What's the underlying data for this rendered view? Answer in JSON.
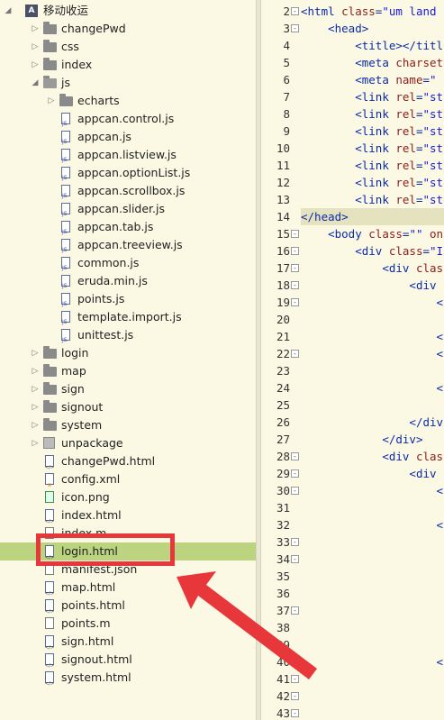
{
  "tree": {
    "root": {
      "label": "移动收运"
    },
    "items": [
      {
        "label": "changePwd",
        "type": "folder",
        "depth": 1,
        "expanded": false
      },
      {
        "label": "css",
        "type": "folder",
        "depth": 1,
        "expanded": false
      },
      {
        "label": "index",
        "type": "folder",
        "depth": 1,
        "expanded": false
      },
      {
        "label": "js",
        "type": "folder",
        "depth": 1,
        "expanded": true
      },
      {
        "label": "echarts",
        "type": "folder",
        "depth": 2,
        "expanded": false
      },
      {
        "label": "appcan.control.js",
        "type": "js",
        "depth": 2
      },
      {
        "label": "appcan.js",
        "type": "js",
        "depth": 2
      },
      {
        "label": "appcan.listview.js",
        "type": "js",
        "depth": 2
      },
      {
        "label": "appcan.optionList.js",
        "type": "js",
        "depth": 2
      },
      {
        "label": "appcan.scrollbox.js",
        "type": "js",
        "depth": 2
      },
      {
        "label": "appcan.slider.js",
        "type": "js",
        "depth": 2
      },
      {
        "label": "appcan.tab.js",
        "type": "js",
        "depth": 2
      },
      {
        "label": "appcan.treeview.js",
        "type": "js",
        "depth": 2
      },
      {
        "label": "common.js",
        "type": "js",
        "depth": 2
      },
      {
        "label": "eruda.min.js",
        "type": "js",
        "depth": 2
      },
      {
        "label": "points.js",
        "type": "js",
        "depth": 2
      },
      {
        "label": "template.import.js",
        "type": "js",
        "depth": 2
      },
      {
        "label": "unittest.js",
        "type": "js",
        "depth": 2
      },
      {
        "label": "login",
        "type": "folder",
        "depth": 1,
        "expanded": false
      },
      {
        "label": "map",
        "type": "folder",
        "depth": 1,
        "expanded": false
      },
      {
        "label": "sign",
        "type": "folder",
        "depth": 1,
        "expanded": false
      },
      {
        "label": "signout",
        "type": "folder",
        "depth": 1,
        "expanded": false
      },
      {
        "label": "system",
        "type": "folder",
        "depth": 1,
        "expanded": false
      },
      {
        "label": "unpackage",
        "type": "package",
        "depth": 1,
        "expanded": false
      },
      {
        "label": "changePwd.html",
        "type": "html",
        "depth": 1
      },
      {
        "label": "config.xml",
        "type": "xml",
        "depth": 1
      },
      {
        "label": "icon.png",
        "type": "png",
        "depth": 1
      },
      {
        "label": "index.html",
        "type": "html",
        "depth": 1
      },
      {
        "label": "index.m",
        "type": "file",
        "depth": 1
      },
      {
        "label": "login.html",
        "type": "html",
        "depth": 1,
        "selected": true
      },
      {
        "label": "manifest.json",
        "type": "file",
        "depth": 1
      },
      {
        "label": "map.html",
        "type": "html",
        "depth": 1
      },
      {
        "label": "points.html",
        "type": "html",
        "depth": 1
      },
      {
        "label": "points.m",
        "type": "file",
        "depth": 1
      },
      {
        "label": "sign.html",
        "type": "html",
        "depth": 1
      },
      {
        "label": "signout.html",
        "type": "html",
        "depth": 1
      },
      {
        "label": "system.html",
        "type": "html",
        "depth": 1
      }
    ]
  },
  "editor": {
    "lines": [
      {
        "n": "2",
        "fold": "-",
        "code": [
          [
            "tag",
            "<html "
          ],
          [
            "attr",
            "class"
          ],
          [
            "tag",
            "="
          ],
          [
            "val",
            "\"um land"
          ]
        ]
      },
      {
        "n": "3",
        "fold": "-",
        "code": [
          [
            "plain",
            "    "
          ],
          [
            "tag",
            "<head>"
          ]
        ]
      },
      {
        "n": "4",
        "fold": "",
        "code": [
          [
            "plain",
            "        "
          ],
          [
            "tag",
            "<title></titl"
          ]
        ]
      },
      {
        "n": "5",
        "fold": "",
        "code": [
          [
            "plain",
            "        "
          ],
          [
            "tag",
            "<meta "
          ],
          [
            "attr",
            "charset"
          ]
        ]
      },
      {
        "n": "6",
        "fold": "",
        "code": [
          [
            "plain",
            "        "
          ],
          [
            "tag",
            "<meta "
          ],
          [
            "attr",
            "name"
          ],
          [
            "tag",
            "="
          ],
          [
            "val",
            "\""
          ]
        ]
      },
      {
        "n": "7",
        "fold": "",
        "code": [
          [
            "plain",
            "        "
          ],
          [
            "tag",
            "<link "
          ],
          [
            "attr",
            "rel"
          ],
          [
            "tag",
            "="
          ],
          [
            "val",
            "\"st"
          ]
        ]
      },
      {
        "n": "8",
        "fold": "",
        "code": [
          [
            "plain",
            "        "
          ],
          [
            "tag",
            "<link "
          ],
          [
            "attr",
            "rel"
          ],
          [
            "tag",
            "="
          ],
          [
            "val",
            "\"st"
          ]
        ]
      },
      {
        "n": "9",
        "fold": "",
        "code": [
          [
            "plain",
            "        "
          ],
          [
            "tag",
            "<link "
          ],
          [
            "attr",
            "rel"
          ],
          [
            "tag",
            "="
          ],
          [
            "val",
            "\"st"
          ]
        ]
      },
      {
        "n": "10",
        "fold": "",
        "code": [
          [
            "plain",
            "        "
          ],
          [
            "tag",
            "<link "
          ],
          [
            "attr",
            "rel"
          ],
          [
            "tag",
            "="
          ],
          [
            "val",
            "\"st"
          ]
        ]
      },
      {
        "n": "11",
        "fold": "",
        "code": [
          [
            "plain",
            "        "
          ],
          [
            "tag",
            "<link "
          ],
          [
            "attr",
            "rel"
          ],
          [
            "tag",
            "="
          ],
          [
            "val",
            "\"st"
          ]
        ]
      },
      {
        "n": "12",
        "fold": "",
        "code": [
          [
            "plain",
            "        "
          ],
          [
            "tag",
            "<link "
          ],
          [
            "attr",
            "rel"
          ],
          [
            "tag",
            "="
          ],
          [
            "val",
            "\"st"
          ]
        ]
      },
      {
        "n": "13",
        "fold": "",
        "code": [
          [
            "plain",
            "        "
          ],
          [
            "tag",
            "<link "
          ],
          [
            "attr",
            "rel"
          ],
          [
            "tag",
            "="
          ],
          [
            "val",
            "\"st"
          ]
        ]
      },
      {
        "n": "14",
        "fold": "",
        "hl": true,
        "code": [
          [
            "tag",
            "</head>"
          ]
        ]
      },
      {
        "n": "15",
        "fold": "-",
        "code": [
          [
            "plain",
            "    "
          ],
          [
            "tag",
            "<body "
          ],
          [
            "attr",
            "class"
          ],
          [
            "tag",
            "="
          ],
          [
            "val",
            "\"\" "
          ],
          [
            "attr",
            "on"
          ]
        ]
      },
      {
        "n": "16",
        "fold": "-",
        "code": [
          [
            "plain",
            "        "
          ],
          [
            "tag",
            "<div "
          ],
          [
            "attr",
            "class"
          ],
          [
            "tag",
            "="
          ],
          [
            "val",
            "\"I"
          ]
        ]
      },
      {
        "n": "17",
        "fold": "-",
        "code": [
          [
            "plain",
            "            "
          ],
          [
            "tag",
            "<div "
          ],
          [
            "attr",
            "clas"
          ]
        ]
      },
      {
        "n": "18",
        "fold": "-",
        "code": [
          [
            "plain",
            "                "
          ],
          [
            "tag",
            "<div"
          ]
        ]
      },
      {
        "n": "19",
        "fold": "-",
        "code": [
          [
            "plain",
            "                    "
          ],
          [
            "tag",
            "<"
          ]
        ]
      },
      {
        "n": "20",
        "fold": "",
        "code": [
          [
            "plain",
            ""
          ]
        ]
      },
      {
        "n": "21",
        "fold": "",
        "code": [
          [
            "plain",
            "                    "
          ],
          [
            "tag",
            "<"
          ]
        ]
      },
      {
        "n": "22",
        "fold": "-",
        "code": [
          [
            "plain",
            "                    "
          ],
          [
            "tag",
            "<"
          ]
        ]
      },
      {
        "n": "23",
        "fold": "",
        "code": [
          [
            "plain",
            ""
          ]
        ]
      },
      {
        "n": "24",
        "fold": "",
        "code": [
          [
            "plain",
            "                    "
          ],
          [
            "tag",
            "<"
          ]
        ]
      },
      {
        "n": "25",
        "fold": "",
        "code": [
          [
            "plain",
            ""
          ]
        ]
      },
      {
        "n": "26",
        "fold": "",
        "code": [
          [
            "plain",
            "                "
          ],
          [
            "tag",
            "</div"
          ]
        ]
      },
      {
        "n": "27",
        "fold": "",
        "code": [
          [
            "plain",
            "            "
          ],
          [
            "tag",
            "</div>"
          ]
        ]
      },
      {
        "n": "28",
        "fold": "-",
        "code": [
          [
            "plain",
            "            "
          ],
          [
            "tag",
            "<div "
          ],
          [
            "attr",
            "clas"
          ]
        ]
      },
      {
        "n": "29",
        "fold": "-",
        "code": [
          [
            "plain",
            "                "
          ],
          [
            "tag",
            "<div"
          ]
        ]
      },
      {
        "n": "30",
        "fold": "-",
        "code": [
          [
            "plain",
            "                    "
          ],
          [
            "tag",
            "<"
          ]
        ]
      },
      {
        "n": "31",
        "fold": "",
        "code": [
          [
            "plain",
            ""
          ]
        ]
      },
      {
        "n": "32",
        "fold": "",
        "code": [
          [
            "plain",
            "                    "
          ],
          [
            "tag",
            "<"
          ]
        ]
      },
      {
        "n": "33",
        "fold": "-",
        "code": [
          [
            "plain",
            ""
          ]
        ]
      },
      {
        "n": "34",
        "fold": "-",
        "code": [
          [
            "plain",
            ""
          ]
        ]
      },
      {
        "n": "35",
        "fold": "",
        "code": [
          [
            "plain",
            ""
          ]
        ]
      },
      {
        "n": "36",
        "fold": "",
        "code": [
          [
            "plain",
            ""
          ]
        ]
      },
      {
        "n": "37",
        "fold": "-",
        "code": [
          [
            "plain",
            ""
          ]
        ]
      },
      {
        "n": "38",
        "fold": "",
        "code": [
          [
            "plain",
            ""
          ]
        ]
      },
      {
        "n": "39",
        "fold": "",
        "code": [
          [
            "plain",
            ""
          ]
        ]
      },
      {
        "n": "40",
        "fold": "",
        "code": [
          [
            "plain",
            "                    "
          ],
          [
            "tag",
            "<"
          ]
        ]
      },
      {
        "n": "41",
        "fold": "-",
        "code": [
          [
            "plain",
            ""
          ]
        ]
      },
      {
        "n": "42",
        "fold": "-",
        "code": [
          [
            "plain",
            ""
          ]
        ]
      },
      {
        "n": "43",
        "fold": "-",
        "code": [
          [
            "plain",
            ""
          ]
        ]
      }
    ]
  },
  "annotation": {
    "color": "#e8373a"
  }
}
